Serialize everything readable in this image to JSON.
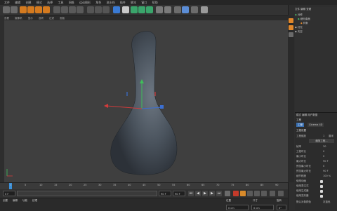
{
  "app": {
    "title": "Cinema 4D"
  },
  "menu": [
    "文件",
    "编辑",
    "创建",
    "模式",
    "选择",
    "工具",
    "网格",
    "运动图形",
    "角色",
    "流水线",
    "插件",
    "脚本",
    "窗口",
    "帮助"
  ],
  "viewport": {
    "header": [
      "查看",
      "摄像机",
      "显示",
      "选项",
      "过滤",
      "面板"
    ],
    "label": "透视视图"
  },
  "timeline": {
    "ticks": [
      "0",
      "5",
      "10",
      "15",
      "20",
      "25",
      "30",
      "35",
      "40",
      "45",
      "50",
      "55",
      "60",
      "65",
      "70",
      "75",
      "80",
      "85",
      "90"
    ],
    "current_frame": "0 F",
    "start_field": "0 F",
    "end_field": "90 F",
    "end_field2": "90 F"
  },
  "bottom": {
    "menus": [
      "创建",
      "编辑",
      "功能",
      "纹理"
    ],
    "labels": [
      "位置",
      "尺寸",
      "旋转"
    ],
    "x_pos": "0 cm",
    "x_size": "0 cm",
    "x_rot": "0°"
  },
  "object_manager": {
    "menus": [
      "文件",
      "编辑",
      "查看",
      "对象",
      "标签",
      "书签"
    ],
    "items": [
      "对称",
      "细分曲面",
      "样条",
      "灯光",
      "天空"
    ]
  },
  "attribute_manager": {
    "menus": [
      "模式",
      "编辑",
      "用户数据"
    ],
    "tab": "工程",
    "tab2": "Cinema 4D",
    "section": "工程设置",
    "rows": [
      "工程缩放",
      "帧率",
      "工程时长",
      "最小时长",
      "最大时长",
      "预览最小时长",
      "预览最大时长",
      "细节程度",
      "使用动画",
      "使用表达式",
      "使用生成器",
      "使用变形器"
    ],
    "values": [
      "1",
      "30",
      "0",
      "0",
      "90 F",
      "0",
      "90 F",
      "100 %"
    ],
    "scale_unit": "厘米",
    "scale_button": "缩放工程...",
    "default_color": "默认对象颜色",
    "color_value": "灰蓝色"
  },
  "colors": {
    "accent": "#e0872b",
    "model": "#4a5460"
  },
  "icons": [
    "undo-icon",
    "redo-icon",
    "select-icon",
    "move-icon",
    "scale-icon",
    "rotate-icon",
    "play-icon",
    "render-icon"
  ]
}
